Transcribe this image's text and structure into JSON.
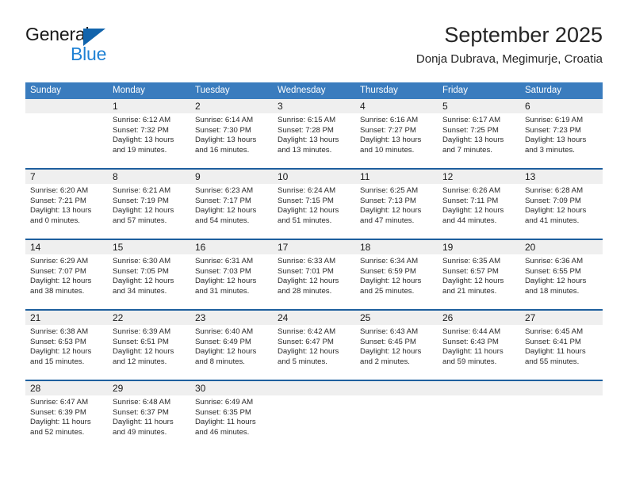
{
  "brand": {
    "name_part1": "General",
    "name_part2": "Blue",
    "accent_color": "#1264ac"
  },
  "header": {
    "title": "September 2025",
    "subtitle": "Donja Dubrava, Megimurje, Croatia"
  },
  "calendar": {
    "header_color": "#3a7cbe",
    "week_divider_color": "#1e5f9e",
    "day_band_color": "#efefef",
    "weekdays": [
      "Sunday",
      "Monday",
      "Tuesday",
      "Wednesday",
      "Thursday",
      "Friday",
      "Saturday"
    ],
    "weeks": [
      [
        {
          "number": "",
          "sunrise": "",
          "sunset": "",
          "daylight_line1": "",
          "daylight_line2": "",
          "empty": true
        },
        {
          "number": "1",
          "sunrise": "Sunrise: 6:12 AM",
          "sunset": "Sunset: 7:32 PM",
          "daylight_line1": "Daylight: 13 hours",
          "daylight_line2": "and 19 minutes."
        },
        {
          "number": "2",
          "sunrise": "Sunrise: 6:14 AM",
          "sunset": "Sunset: 7:30 PM",
          "daylight_line1": "Daylight: 13 hours",
          "daylight_line2": "and 16 minutes."
        },
        {
          "number": "3",
          "sunrise": "Sunrise: 6:15 AM",
          "sunset": "Sunset: 7:28 PM",
          "daylight_line1": "Daylight: 13 hours",
          "daylight_line2": "and 13 minutes."
        },
        {
          "number": "4",
          "sunrise": "Sunrise: 6:16 AM",
          "sunset": "Sunset: 7:27 PM",
          "daylight_line1": "Daylight: 13 hours",
          "daylight_line2": "and 10 minutes."
        },
        {
          "number": "5",
          "sunrise": "Sunrise: 6:17 AM",
          "sunset": "Sunset: 7:25 PM",
          "daylight_line1": "Daylight: 13 hours",
          "daylight_line2": "and 7 minutes."
        },
        {
          "number": "6",
          "sunrise": "Sunrise: 6:19 AM",
          "sunset": "Sunset: 7:23 PM",
          "daylight_line1": "Daylight: 13 hours",
          "daylight_line2": "and 3 minutes."
        }
      ],
      [
        {
          "number": "7",
          "sunrise": "Sunrise: 6:20 AM",
          "sunset": "Sunset: 7:21 PM",
          "daylight_line1": "Daylight: 13 hours",
          "daylight_line2": "and 0 minutes."
        },
        {
          "number": "8",
          "sunrise": "Sunrise: 6:21 AM",
          "sunset": "Sunset: 7:19 PM",
          "daylight_line1": "Daylight: 12 hours",
          "daylight_line2": "and 57 minutes."
        },
        {
          "number": "9",
          "sunrise": "Sunrise: 6:23 AM",
          "sunset": "Sunset: 7:17 PM",
          "daylight_line1": "Daylight: 12 hours",
          "daylight_line2": "and 54 minutes."
        },
        {
          "number": "10",
          "sunrise": "Sunrise: 6:24 AM",
          "sunset": "Sunset: 7:15 PM",
          "daylight_line1": "Daylight: 12 hours",
          "daylight_line2": "and 51 minutes."
        },
        {
          "number": "11",
          "sunrise": "Sunrise: 6:25 AM",
          "sunset": "Sunset: 7:13 PM",
          "daylight_line1": "Daylight: 12 hours",
          "daylight_line2": "and 47 minutes."
        },
        {
          "number": "12",
          "sunrise": "Sunrise: 6:26 AM",
          "sunset": "Sunset: 7:11 PM",
          "daylight_line1": "Daylight: 12 hours",
          "daylight_line2": "and 44 minutes."
        },
        {
          "number": "13",
          "sunrise": "Sunrise: 6:28 AM",
          "sunset": "Sunset: 7:09 PM",
          "daylight_line1": "Daylight: 12 hours",
          "daylight_line2": "and 41 minutes."
        }
      ],
      [
        {
          "number": "14",
          "sunrise": "Sunrise: 6:29 AM",
          "sunset": "Sunset: 7:07 PM",
          "daylight_line1": "Daylight: 12 hours",
          "daylight_line2": "and 38 minutes."
        },
        {
          "number": "15",
          "sunrise": "Sunrise: 6:30 AM",
          "sunset": "Sunset: 7:05 PM",
          "daylight_line1": "Daylight: 12 hours",
          "daylight_line2": "and 34 minutes."
        },
        {
          "number": "16",
          "sunrise": "Sunrise: 6:31 AM",
          "sunset": "Sunset: 7:03 PM",
          "daylight_line1": "Daylight: 12 hours",
          "daylight_line2": "and 31 minutes."
        },
        {
          "number": "17",
          "sunrise": "Sunrise: 6:33 AM",
          "sunset": "Sunset: 7:01 PM",
          "daylight_line1": "Daylight: 12 hours",
          "daylight_line2": "and 28 minutes."
        },
        {
          "number": "18",
          "sunrise": "Sunrise: 6:34 AM",
          "sunset": "Sunset: 6:59 PM",
          "daylight_line1": "Daylight: 12 hours",
          "daylight_line2": "and 25 minutes."
        },
        {
          "number": "19",
          "sunrise": "Sunrise: 6:35 AM",
          "sunset": "Sunset: 6:57 PM",
          "daylight_line1": "Daylight: 12 hours",
          "daylight_line2": "and 21 minutes."
        },
        {
          "number": "20",
          "sunrise": "Sunrise: 6:36 AM",
          "sunset": "Sunset: 6:55 PM",
          "daylight_line1": "Daylight: 12 hours",
          "daylight_line2": "and 18 minutes."
        }
      ],
      [
        {
          "number": "21",
          "sunrise": "Sunrise: 6:38 AM",
          "sunset": "Sunset: 6:53 PM",
          "daylight_line1": "Daylight: 12 hours",
          "daylight_line2": "and 15 minutes."
        },
        {
          "number": "22",
          "sunrise": "Sunrise: 6:39 AM",
          "sunset": "Sunset: 6:51 PM",
          "daylight_line1": "Daylight: 12 hours",
          "daylight_line2": "and 12 minutes."
        },
        {
          "number": "23",
          "sunrise": "Sunrise: 6:40 AM",
          "sunset": "Sunset: 6:49 PM",
          "daylight_line1": "Daylight: 12 hours",
          "daylight_line2": "and 8 minutes."
        },
        {
          "number": "24",
          "sunrise": "Sunrise: 6:42 AM",
          "sunset": "Sunset: 6:47 PM",
          "daylight_line1": "Daylight: 12 hours",
          "daylight_line2": "and 5 minutes."
        },
        {
          "number": "25",
          "sunrise": "Sunrise: 6:43 AM",
          "sunset": "Sunset: 6:45 PM",
          "daylight_line1": "Daylight: 12 hours",
          "daylight_line2": "and 2 minutes."
        },
        {
          "number": "26",
          "sunrise": "Sunrise: 6:44 AM",
          "sunset": "Sunset: 6:43 PM",
          "daylight_line1": "Daylight: 11 hours",
          "daylight_line2": "and 59 minutes."
        },
        {
          "number": "27",
          "sunrise": "Sunrise: 6:45 AM",
          "sunset": "Sunset: 6:41 PM",
          "daylight_line1": "Daylight: 11 hours",
          "daylight_line2": "and 55 minutes."
        }
      ],
      [
        {
          "number": "28",
          "sunrise": "Sunrise: 6:47 AM",
          "sunset": "Sunset: 6:39 PM",
          "daylight_line1": "Daylight: 11 hours",
          "daylight_line2": "and 52 minutes."
        },
        {
          "number": "29",
          "sunrise": "Sunrise: 6:48 AM",
          "sunset": "Sunset: 6:37 PM",
          "daylight_line1": "Daylight: 11 hours",
          "daylight_line2": "and 49 minutes."
        },
        {
          "number": "30",
          "sunrise": "Sunrise: 6:49 AM",
          "sunset": "Sunset: 6:35 PM",
          "daylight_line1": "Daylight: 11 hours",
          "daylight_line2": "and 46 minutes."
        },
        {
          "number": "",
          "sunrise": "",
          "sunset": "",
          "daylight_line1": "",
          "daylight_line2": "",
          "empty": true
        },
        {
          "number": "",
          "sunrise": "",
          "sunset": "",
          "daylight_line1": "",
          "daylight_line2": "",
          "empty": true
        },
        {
          "number": "",
          "sunrise": "",
          "sunset": "",
          "daylight_line1": "",
          "daylight_line2": "",
          "empty": true
        },
        {
          "number": "",
          "sunrise": "",
          "sunset": "",
          "daylight_line1": "",
          "daylight_line2": "",
          "empty": true
        }
      ]
    ]
  }
}
